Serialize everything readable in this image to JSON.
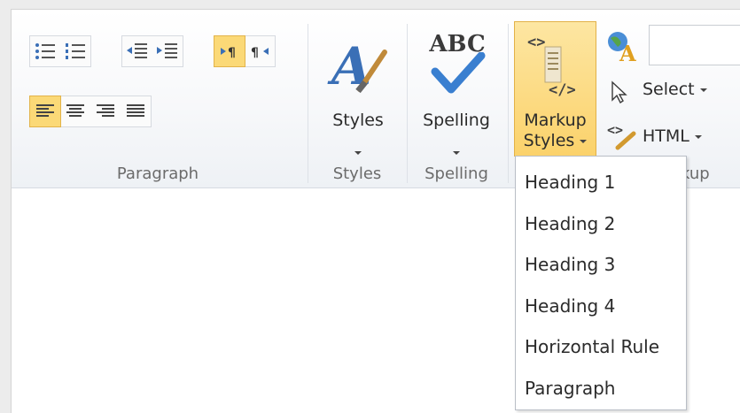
{
  "ribbon": {
    "groups": {
      "paragraph": "Paragraph",
      "styles": "Styles",
      "spelling": "Spelling",
      "markup_partial": "kup"
    },
    "styles_button": "Styles",
    "spelling_button": "Spelling",
    "spelling_icon_text": "ABC",
    "markup_styles_button": {
      "line1": "Markup",
      "line2": "Styles"
    },
    "select_button": "Select",
    "html_button": "HTML"
  },
  "menu": {
    "items": [
      "Heading 1",
      "Heading 2",
      "Heading 3",
      "Heading 4",
      "Horizontal Rule",
      "Paragraph"
    ]
  },
  "colors": {
    "accent": "#fbd26b",
    "accent_border": "#e2b148",
    "icon_blue": "#3a6fb6"
  }
}
